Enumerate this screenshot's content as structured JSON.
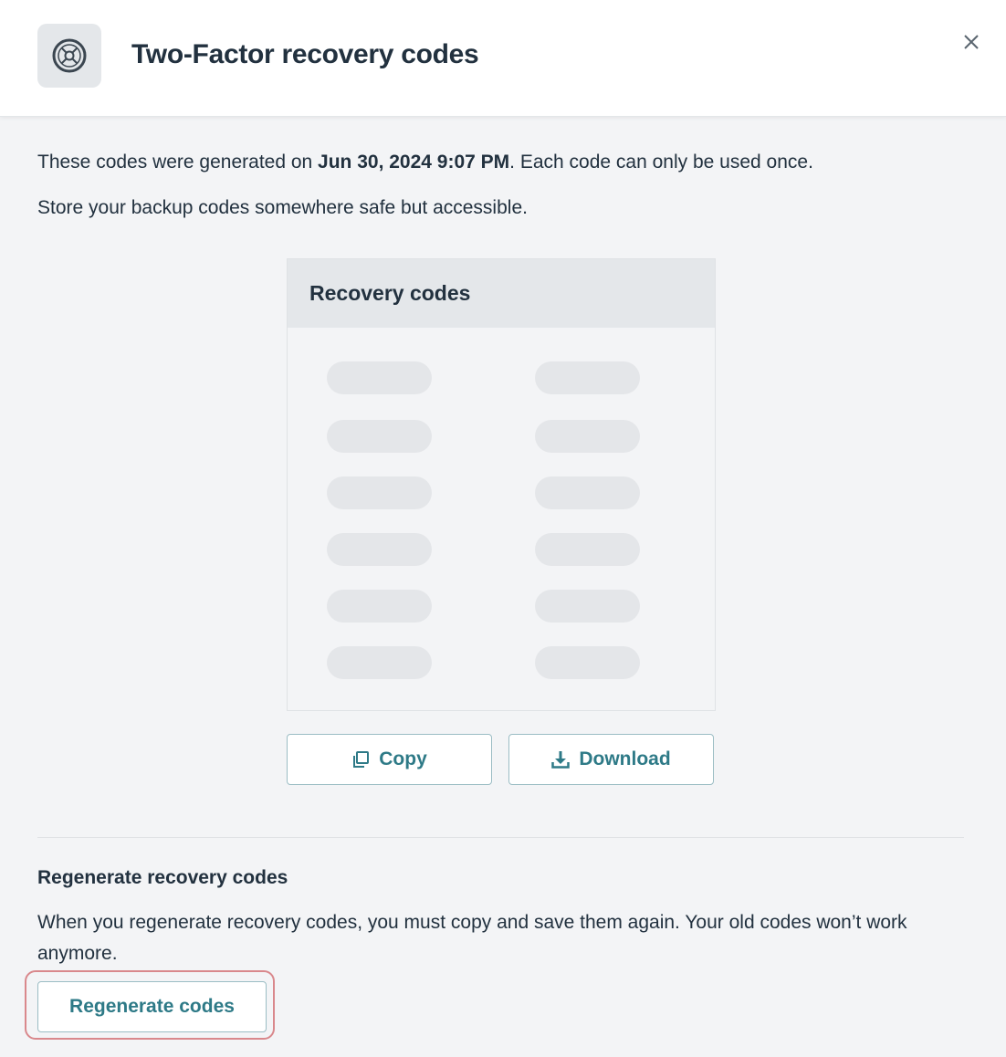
{
  "dialog": {
    "title": "Two-Factor recovery codes",
    "header_icon": "safe-vault-icon",
    "close_icon": "close-icon"
  },
  "intro": {
    "prefix": "These codes were generated on ",
    "date": "Jun 30, 2024 9:07 PM",
    "suffix": ". Each code can only be used once.",
    "note": "Store your backup codes somewhere safe but accessible."
  },
  "codes_panel": {
    "title": "Recovery codes",
    "rows": 6,
    "columns": 2,
    "state": "loading"
  },
  "actions": {
    "copy_label": "Copy",
    "copy_icon": "copy-icon",
    "download_label": "Download",
    "download_icon": "download-icon"
  },
  "regenerate": {
    "title": "Regenerate recovery codes",
    "description": "When you regenerate recovery codes, you must copy and save them again. Your old codes won’t work anymore.",
    "button_label": "Regenerate codes"
  },
  "colors": {
    "accent": "#2e7a87",
    "highlight_outline": "#d9888c",
    "text": "#22313f"
  }
}
